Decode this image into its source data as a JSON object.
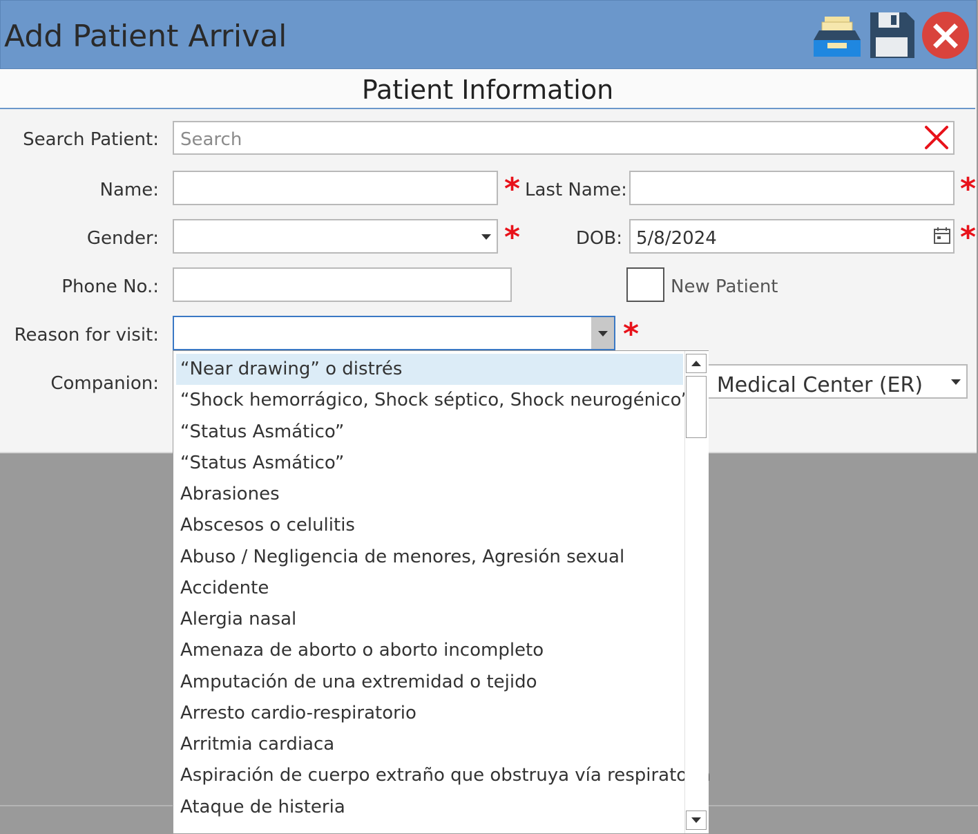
{
  "window": {
    "title": "Add Patient Arrival"
  },
  "toolbar": {
    "archive_icon": "archive-tray-icon",
    "save_icon": "floppy-disk-icon",
    "close_icon": "close-x-icon"
  },
  "section": {
    "title": "Patient Information"
  },
  "form": {
    "search_label": "Search Patient:",
    "search_placeholder": "Search",
    "name_label": "Name:",
    "last_name_label": "Last Name:",
    "gender_label": "Gender:",
    "dob_label": "DOB:",
    "dob_value": "5/8/2024",
    "phone_label": "Phone No.:",
    "new_patient_label": "New Patient",
    "reason_label": "Reason for visit:",
    "companion_label": "Companion:",
    "facility_value": "l Medical Center (ER)",
    "required_mark": "*"
  },
  "reason_options": [
    "“Near drawing” o distrés",
    "“Shock hemorrágico, Shock séptico, Shock neurogénico”",
    "“Status Asmático”",
    "“Status Asmático”",
    "Abrasiones",
    "Abscesos o celulitis",
    "Abuso / Negligencia de menores, Agresión sexual",
    "Accidente",
    "Alergia nasal",
    "Amenaza de aborto o aborto incompleto",
    "Amputación de una extremidad o tejido",
    "Arresto cardio-respiratorio",
    "Arritmia cardiaca",
    "Aspiración de cuerpo extraño que obstruya vía respiratoria",
    "Ataque de histeria"
  ],
  "colors": {
    "accent": "#6b97cb",
    "required": "#e8121a",
    "selected_option": "#dcecf7"
  }
}
